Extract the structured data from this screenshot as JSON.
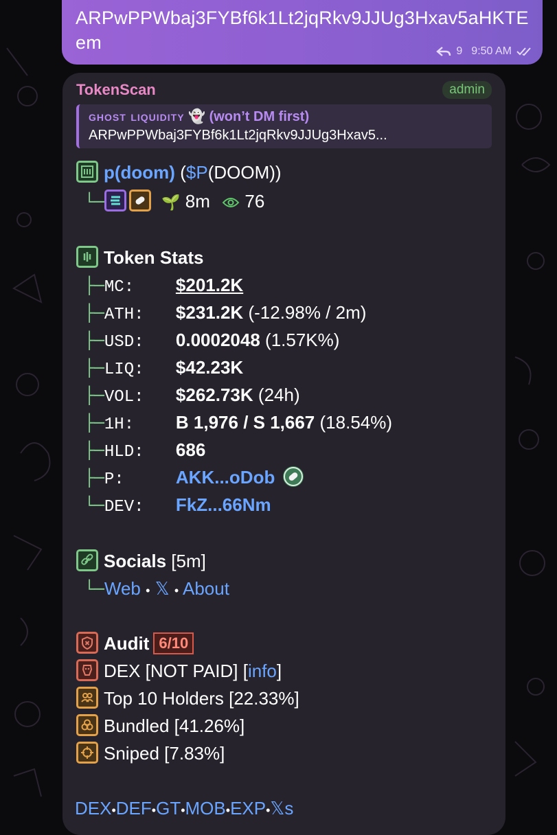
{
  "outgoing": {
    "text": "ARPwPPWbaj3FYBf6k1Lt2jqRkv9JJUg3Hxav5aHKTEem",
    "replies": "9",
    "time": "9:50 AM"
  },
  "incoming": {
    "sender": "TokenScan",
    "badge": "admin",
    "reply": {
      "title_caps": "ghost liquidity",
      "title_emoji": "👻",
      "title_rest": "(won’t DM first)",
      "text": "ARPwPPWbaj3FYBf6k1Lt2jqRkv9JJUg3Hxav5..."
    },
    "token": {
      "name": "p(doom)",
      "open": "(",
      "ticker_prefix": "$P",
      "ticker_rest": "(DOOM))",
      "age": "8m",
      "views": "76"
    },
    "stats": {
      "title": "Token Stats",
      "rows": [
        {
          "label": "MC:",
          "value": "$201.2K",
          "extra": ""
        },
        {
          "label": "ATH:",
          "value": "$231.2K",
          "extra": "(-12.98% / 2m)"
        },
        {
          "label": "USD:",
          "value": "0.0002048",
          "extra": "(1.57K%)"
        },
        {
          "label": "LIQ:",
          "value": "$42.23K",
          "extra": ""
        },
        {
          "label": "VOL:",
          "value": "$262.73K",
          "extra": "(24h)"
        },
        {
          "label": "1H:",
          "value": "B 1,976 / S 1,667",
          "extra": "(18.54%)"
        },
        {
          "label": "HLD:",
          "value": "686",
          "extra": ""
        },
        {
          "label": "P:",
          "value": "AKK...oDob",
          "extra": ""
        },
        {
          "label": "DEV:",
          "value": "FkZ...66Nm",
          "extra": ""
        }
      ]
    },
    "socials": {
      "title": "Socials",
      "age": "[5m]",
      "links": [
        "Web",
        "𝕏",
        "About"
      ],
      "sep": "•"
    },
    "audit": {
      "title": "Audit",
      "score": "6/10",
      "dex": "DEX [NOT PAID] [",
      "dex_link": "info",
      "dex_end": "]",
      "top10": "Top 10 Holders [22.33%]",
      "bundled": "Bundled [41.26%]",
      "sniped": "Sniped [7.83%]"
    },
    "footer_links": [
      "DEX",
      "DEF",
      "GT",
      "MOB",
      "EXP",
      "𝕏s"
    ],
    "footer_sep": "•"
  },
  "colors": {
    "outgoing_bubble": "#8b5fd0",
    "incoming_bubble": "#26232c",
    "link": "#6aa5ff",
    "tree": "#7ec98a",
    "sender": "#e889c6",
    "admin": "#77c777"
  }
}
